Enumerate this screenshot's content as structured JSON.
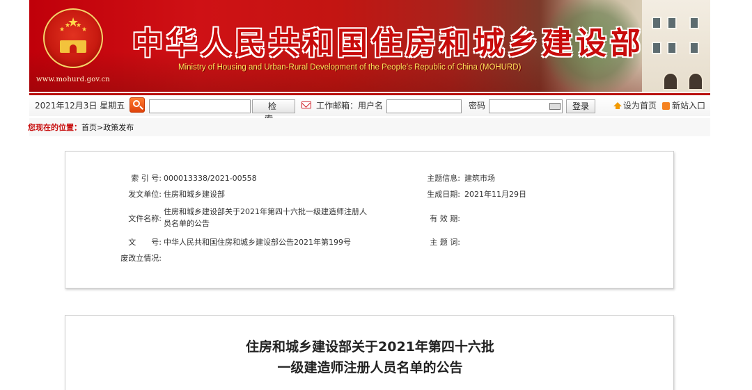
{
  "header": {
    "site_url": "www.mohurd.gov.cn",
    "title_cn": "中华人民共和国住房和城乡建设部",
    "title_en": "Ministry of Housing and Urban-Rural Development of the People's Republic of China (MOHURD)"
  },
  "toolbar": {
    "date": "2021年12月3日 星期五",
    "search_placeholder": "",
    "search_button": "检索",
    "mail_label": "工作邮箱：用户名",
    "username_value": "",
    "password_label": "密码",
    "password_value": "",
    "login_button": "登录",
    "set_home": "设为首页",
    "new_site": "新站入口"
  },
  "breadcrumb": {
    "prefix": "您现在的位置：",
    "home": "首页",
    "separator": ">",
    "current": "政策发布"
  },
  "info": {
    "index_label": "索 引 号:",
    "index_value": "000013338/2021-00558",
    "issuer_label": "发文单位:",
    "issuer_value": "住房和城乡建设部",
    "filename_label": "文件名称:",
    "filename_value": "住房和城乡建设部关于2021年第四十六批一级建造师注册人员名单的公告",
    "docno_label": "文　　号:",
    "docno_value": "中华人民共和国住房和城乡建设部公告2021年第199号",
    "status_label": "废改立情况:",
    "status_value": "",
    "topic_label": "主题信息:",
    "topic_value": "建筑市场",
    "date_label": "生成日期:",
    "date_value": "2021年11月29日",
    "validity_label": "有 效 期:",
    "validity_value": "",
    "keywords_label": "主 题 词:",
    "keywords_value": ""
  },
  "article": {
    "title_line1": "住房和城乡建设部关于2021年第四十六批",
    "title_line2": "一级建造师注册人员名单的公告"
  },
  "colors": {
    "brand_red": "#c80b0b",
    "toolbar_border": "#b9100e",
    "accent_orange": "#e0420a"
  }
}
